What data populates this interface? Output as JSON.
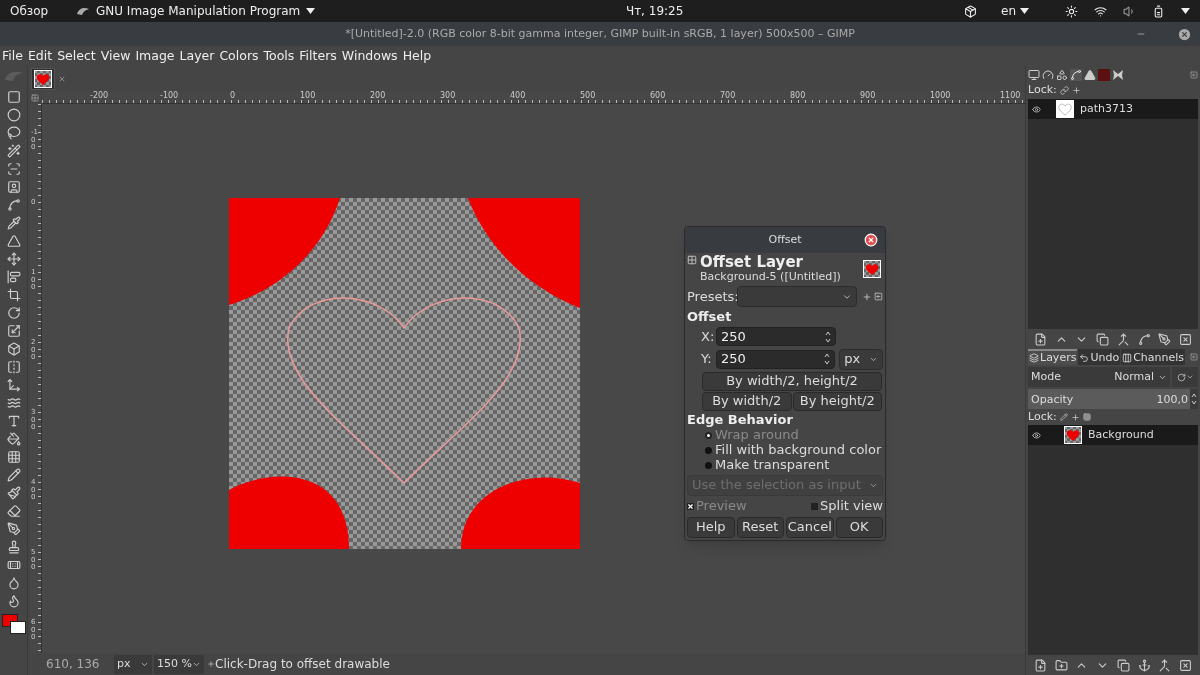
{
  "topbar": {
    "activities": "Обзор",
    "app_menu": "GNU Image Manipulation Program",
    "clock": "Чт, 19:25",
    "language": "en"
  },
  "window": {
    "title": "*[Untitled]-2.0 (RGB color 8-bit gamma integer, GIMP built-in sRGB, 1 layer) 500x500 – GIMP"
  },
  "menu": [
    "File",
    "Edit",
    "Select",
    "View",
    "Image",
    "Layer",
    "Colors",
    "Tools",
    "Filters",
    "Windows",
    "Help"
  ],
  "rulers": {
    "horizontal": [
      "-200",
      "-100",
      "0",
      "100",
      "200",
      "300",
      "400",
      "500",
      "600",
      "700",
      "800",
      "900",
      "1000",
      "1100"
    ],
    "vertical": [
      "-100",
      "0",
      "100",
      "200",
      "300",
      "400",
      "500",
      "600"
    ]
  },
  "dialog": {
    "title": "Offset",
    "heading": "Offset Layer",
    "subtitle": "Background-5 ([Untitled])",
    "presets_label": "Presets:",
    "offset_label": "Offset",
    "fields": [
      {
        "label": "X:",
        "value": "250"
      },
      {
        "label": "Y:",
        "value": "250"
      }
    ],
    "unit": "px",
    "shortcuts": [
      "By width/2, height/2",
      "By width/2",
      "By height/2"
    ],
    "edge_label": "Edge Behavior",
    "edge_options": [
      {
        "label": "Wrap around",
        "selected": true,
        "disabled": true
      },
      {
        "label": "Fill with background color",
        "selected": false,
        "disabled": false
      },
      {
        "label": "Make transparent",
        "selected": false,
        "disabled": false
      }
    ],
    "selection_input": {
      "value": "Use the selection as input",
      "disabled": true
    },
    "preview": {
      "label": "Preview",
      "checked": true,
      "disabled": true
    },
    "split_view": {
      "label": "Split view",
      "checked": false
    },
    "actions": [
      "Help",
      "Reset",
      "Cancel",
      "OK"
    ]
  },
  "dock": {
    "paths_lock_label": "Lock:",
    "paths": [
      {
        "name": "path3713",
        "selected": true,
        "visible": true
      }
    ],
    "tabs": [
      {
        "label": "Layers",
        "selected": true
      },
      {
        "label": "Undo",
        "selected": false
      },
      {
        "label": "Channels",
        "selected": false
      }
    ],
    "mode_label": "Mode",
    "mode_value": "Normal",
    "opacity_label": "Opacity",
    "opacity_value": "100,0",
    "opacity": {
      "level": 1
    },
    "layers_lock_label": "Lock:",
    "layers": [
      {
        "name": "Background",
        "selected": true,
        "visible": true
      }
    ]
  },
  "status": {
    "coords": "610, 136",
    "unit": "px",
    "zoom": "150 %",
    "message": "Click-Drag to offset drawable"
  }
}
